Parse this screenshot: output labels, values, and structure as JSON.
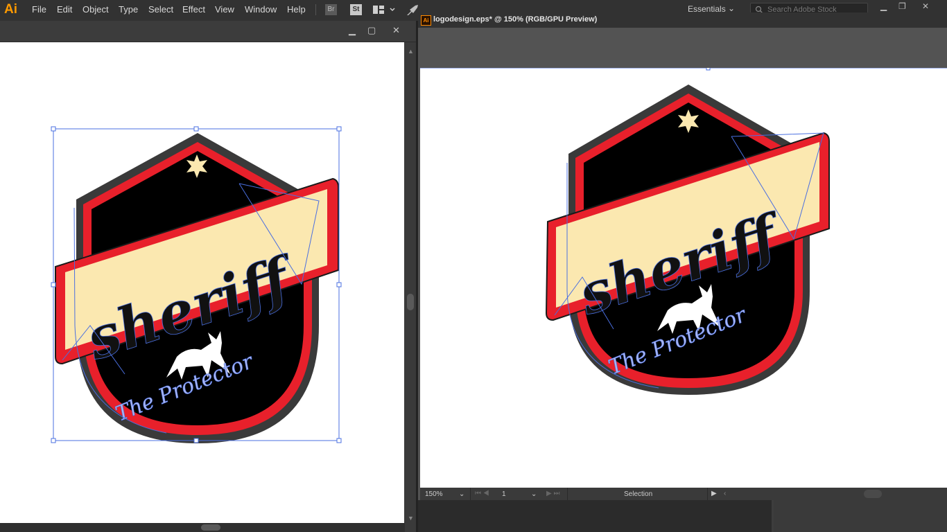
{
  "app": {
    "logo": "Ai",
    "menu": [
      "File",
      "Edit",
      "Object",
      "Type",
      "Select",
      "Effect",
      "View",
      "Window",
      "Help"
    ],
    "toolbar_icons": [
      "bridge-icon",
      "stock-icon",
      "arrange-documents-icon",
      "gpu-rocket-icon"
    ],
    "toolbar_labels": {
      "bridge": "Br",
      "stock": "St"
    },
    "workspace": "Essentials",
    "search_placeholder": "Search Adobe Stock"
  },
  "right_document": {
    "title": "logodesign.eps* @ 150% (RGB/GPU Preview)",
    "status": {
      "zoom": "150%",
      "page": "1",
      "tool": "Selection"
    }
  },
  "artwork": {
    "headline": "sheriff",
    "tagline": "The Protector"
  },
  "colors": {
    "badge_black": "#000000",
    "badge_red": "#e8202b",
    "badge_gray": "#3a3a3a",
    "banner_cream": "#fbe8b0",
    "selection_blue": "#4a6fe0",
    "star": "#fbe8b0",
    "tagline": "#a9b6f2",
    "accent_orange": "#ff9a00"
  }
}
